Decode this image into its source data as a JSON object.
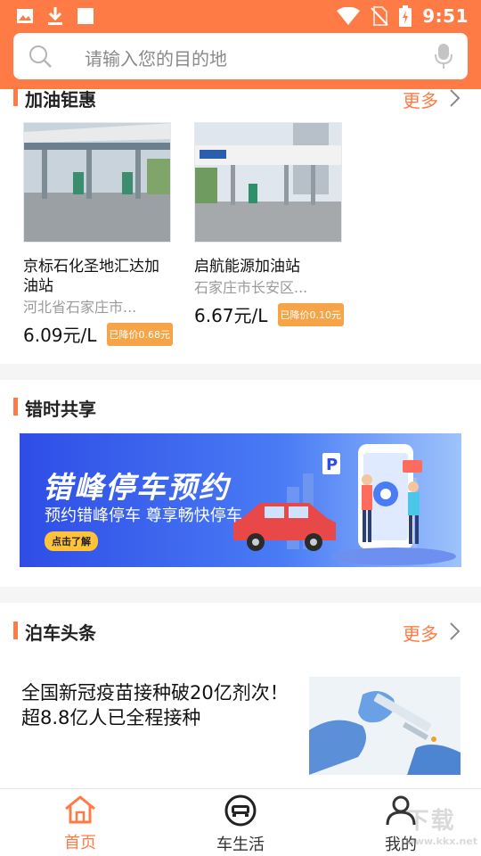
{
  "status_bar": {
    "time": "9:51",
    "left_icons": [
      "image-icon",
      "download-icon",
      "square-icon"
    ],
    "right_icons": [
      "wifi-icon",
      "no-sim-icon",
      "battery-charging-icon"
    ]
  },
  "search": {
    "placeholder": "请输入您的目的地"
  },
  "gas_section": {
    "title": "加油钜惠",
    "more_label": "更多",
    "stations": [
      {
        "name": "京标石化圣地汇达加油站",
        "address": "河北省石家庄市...",
        "price": "6.09元/L",
        "discount": "已降价0.68元"
      },
      {
        "name": "启航能源加油站",
        "address": "石家庄市长安区...",
        "price": "6.67元/L",
        "discount": "已降价0.10元"
      }
    ]
  },
  "share_section": {
    "title": "错时共享",
    "banner": {
      "title": "错峰停车预约",
      "subtitle": "预约错峰停车  尊享畅快停车",
      "button": "点击了解"
    }
  },
  "news_section": {
    "title": "泊车头条",
    "more_label": "更多",
    "article_title": "全国新冠疫苗接种破20亿剂次！超8.8亿人已全程接种"
  },
  "bottom_nav": {
    "items": [
      {
        "label": "首页",
        "icon": "home-icon",
        "active": true
      },
      {
        "label": "车生活",
        "icon": "car-icon",
        "active": false
      },
      {
        "label": "我的",
        "icon": "user-icon",
        "active": false
      }
    ]
  },
  "watermark": {
    "text": "下载",
    "url_text": "www.kkx.net"
  },
  "colors": {
    "accent": "#ff7b45",
    "discount": "#f5a447",
    "banner": "#2e4de6"
  }
}
